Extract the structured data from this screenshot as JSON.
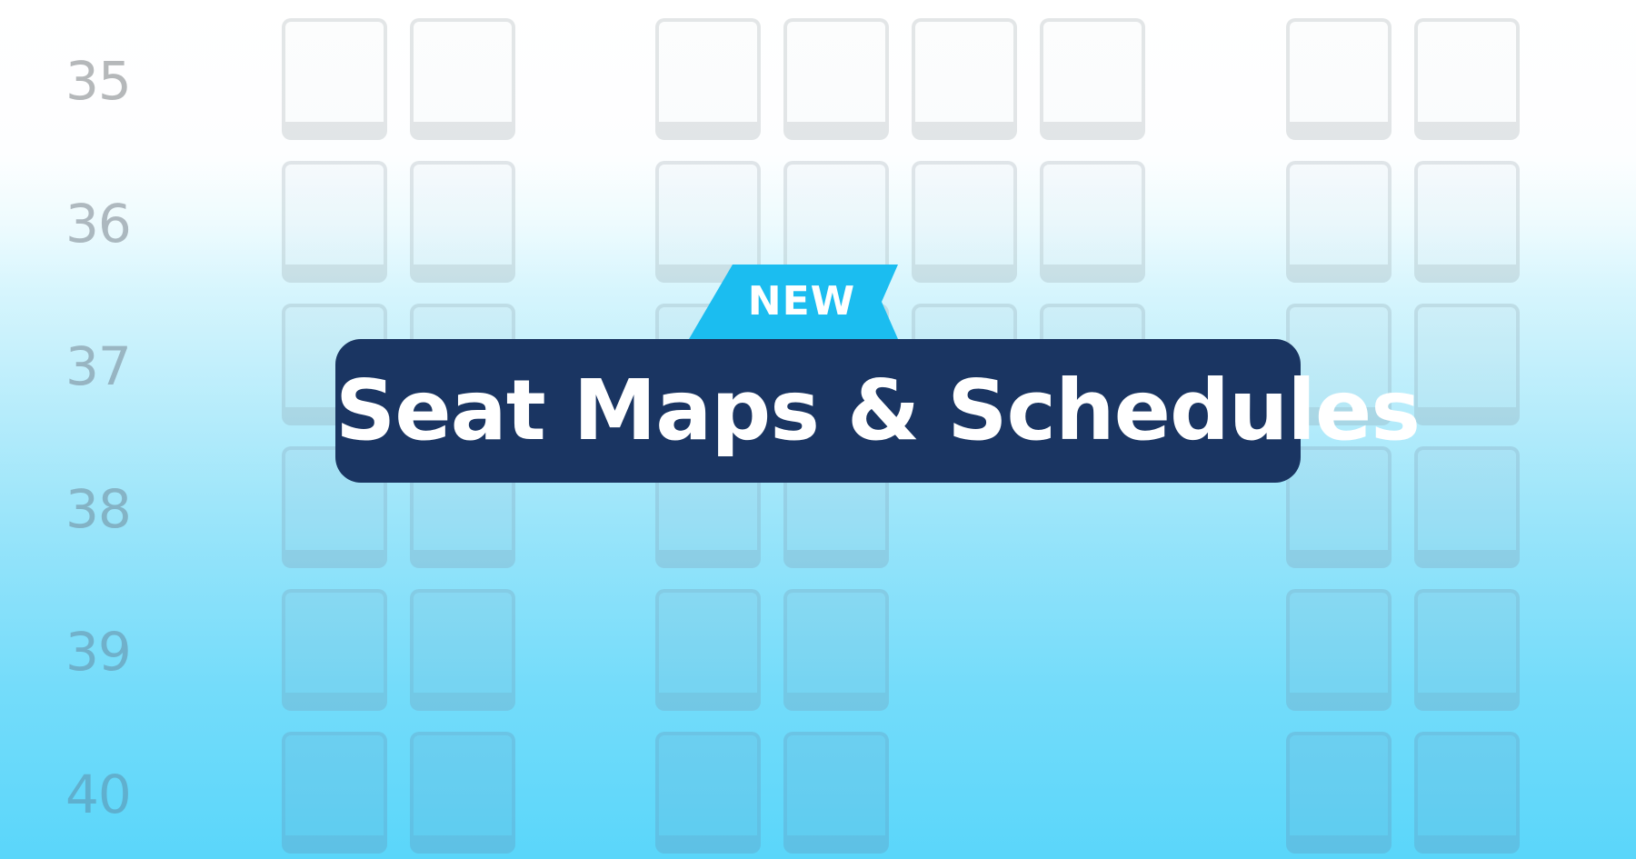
{
  "seat_map": {
    "rows": [
      {
        "number": "35",
        "seats": [
          1,
          1,
          1,
          1,
          1,
          1,
          1,
          1
        ]
      },
      {
        "number": "36",
        "seats": [
          1,
          1,
          1,
          1,
          1,
          1,
          1,
          1
        ]
      },
      {
        "number": "37",
        "seats": [
          1,
          1,
          1,
          1,
          1,
          1,
          1,
          1
        ]
      },
      {
        "number": "38",
        "seats": [
          1,
          1,
          1,
          1,
          0,
          0,
          1,
          1
        ]
      },
      {
        "number": "39",
        "seats": [
          1,
          1,
          1,
          1,
          0,
          0,
          1,
          1
        ]
      },
      {
        "number": "40",
        "seats": [
          1,
          1,
          1,
          1,
          0,
          0,
          1,
          1
        ]
      }
    ]
  },
  "badge": {
    "label": "NEW"
  },
  "title": {
    "text": "Seat Maps & Schedules"
  },
  "colors": {
    "badge": "#1bbdf0",
    "title_background": "#1a3562",
    "title_text": "#ffffff"
  }
}
